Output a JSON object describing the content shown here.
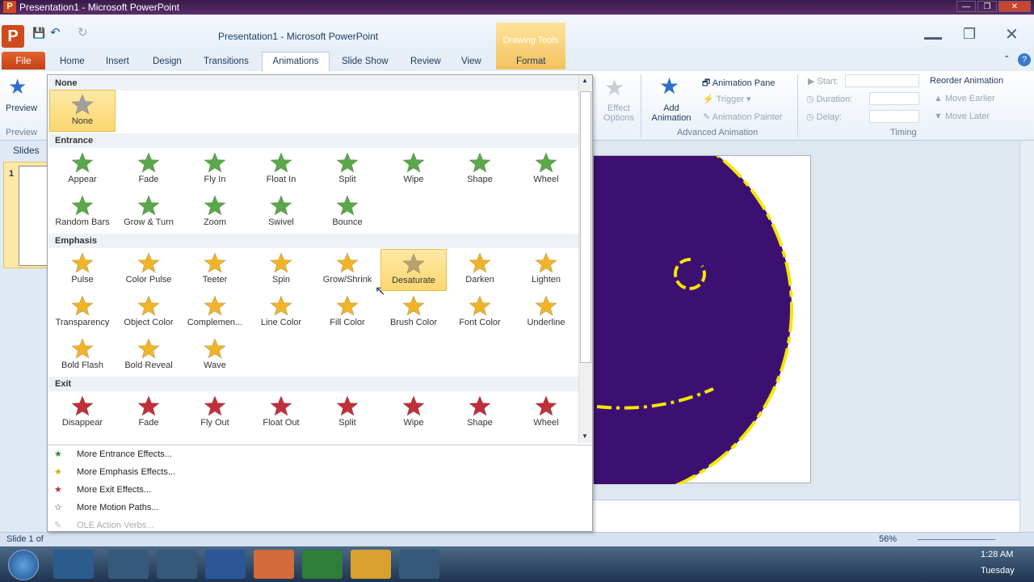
{
  "window": {
    "title": "Presentation1 - Microsoft PowerPoint",
    "app_title": "Presentation1  -  Microsoft PowerPoint",
    "app_icon": "P"
  },
  "tabs": {
    "file": "File",
    "items": [
      "Home",
      "Insert",
      "Design",
      "Transitions",
      "Animations",
      "Slide Show",
      "Review",
      "View"
    ],
    "context_group": "Drawing Tools",
    "context_tab": "Format"
  },
  "ribbon": {
    "preview_label": "Preview",
    "preview_group": "Preview",
    "effect_options": "Effect Options",
    "add_animation": "Add Animation",
    "animation_pane": "Animation Pane",
    "trigger": "Trigger",
    "animation_painter": "Animation Painter",
    "advanced_group": "Advanced Animation",
    "start": "Start:",
    "duration": "Duration:",
    "delay": "Delay:",
    "timing_group": "Timing",
    "reorder": "Reorder Animation",
    "move_earlier": "Move Earlier",
    "move_later": "Move Later"
  },
  "slides_pane": {
    "tab": "Slides",
    "slide_num": "1"
  },
  "gallery": {
    "none_header": "None",
    "none_item": "None",
    "entrance_header": "Entrance",
    "entrance": [
      "Appear",
      "Fade",
      "Fly In",
      "Float In",
      "Split",
      "Wipe",
      "Shape",
      "Wheel",
      "Random Bars",
      "Grow & Turn",
      "Zoom",
      "Swivel",
      "Bounce"
    ],
    "emphasis_header": "Emphasis",
    "emphasis": [
      "Pulse",
      "Color Pulse",
      "Teeter",
      "Spin",
      "Grow/Shrink",
      "Desaturate",
      "Darken",
      "Lighten",
      "Transparency",
      "Object Color",
      "Complemen...",
      "Line Color",
      "Fill Color",
      "Brush Color",
      "Font Color",
      "Underline",
      "Bold Flash",
      "Bold Reveal",
      "Wave"
    ],
    "exit_header": "Exit",
    "exit": [
      "Disappear",
      "Fade",
      "Fly Out",
      "Float Out",
      "Split",
      "Wipe",
      "Shape",
      "Wheel"
    ],
    "menu": [
      "More Entrance Effects...",
      "More Emphasis Effects...",
      "More Exit Effects...",
      "More Motion Paths...",
      "OLE Action Verbs..."
    ]
  },
  "status": {
    "slide": "Slide 1 of",
    "zoom": "56%"
  },
  "taskbar": {
    "time": "1:28 AM",
    "day": "Tuesday"
  },
  "colors": {
    "entrance": "#5aa84a",
    "emphasis": "#f0b429",
    "exit": "#c0303a",
    "slide_circle": "#3c1070",
    "dash": "#f5e600"
  }
}
